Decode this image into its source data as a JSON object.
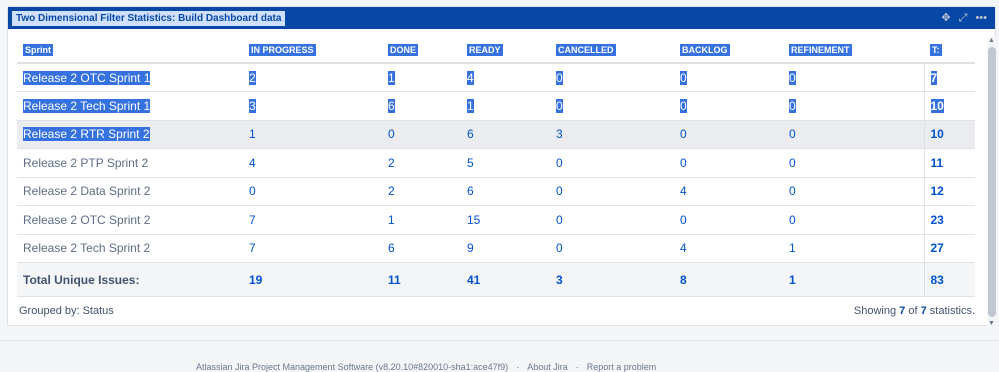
{
  "gadget": {
    "title": "Two Dimensional Filter Statistics: Build Dashboard data",
    "icons": [
      "move-icon",
      "expand-icon",
      "more-icon"
    ]
  },
  "table": {
    "headers": [
      "Sprint",
      "IN PROGRESS",
      "DONE",
      "READY",
      "CANCELLED",
      "BACKLOG",
      "REFINEMENT",
      "T:"
    ],
    "rows": [
      {
        "name": "Release 2 OTC Sprint 1",
        "values": [
          "2",
          "1",
          "4",
          "0",
          "0",
          "0"
        ],
        "total": "7"
      },
      {
        "name": "Release 2 Tech Sprint 1",
        "values": [
          "3",
          "6",
          "1",
          "0",
          "0",
          "0"
        ],
        "total": "10"
      },
      {
        "name": "Release 2 RTR Sprint 2",
        "values": [
          "1",
          "0",
          "6",
          "3",
          "0",
          "0"
        ],
        "total": "10"
      },
      {
        "name": "Release 2 PTP Sprint 2",
        "values": [
          "4",
          "2",
          "5",
          "0",
          "0",
          "0"
        ],
        "total": "11"
      },
      {
        "name": "Release 2 Data Sprint 2",
        "values": [
          "0",
          "2",
          "6",
          "0",
          "4",
          "0"
        ],
        "total": "12"
      },
      {
        "name": "Release 2 OTC Sprint 2",
        "values": [
          "7",
          "1",
          "15",
          "0",
          "0",
          "0"
        ],
        "total": "23"
      },
      {
        "name": "Release 2 Tech Sprint 2",
        "values": [
          "7",
          "6",
          "9",
          "0",
          "4",
          "1"
        ],
        "total": "27"
      }
    ],
    "summary": {
      "label": "Total Unique Issues:",
      "values": [
        "19",
        "11",
        "41",
        "3",
        "8",
        "1"
      ],
      "total": "83"
    }
  },
  "footer": {
    "grouped_by": "Grouped by: Status",
    "showing_prefix": "Showing",
    "shown": "7",
    "of": "of",
    "count": "7",
    "suffix": "statistics."
  },
  "page_footer": {
    "software": "Atlassian Jira Project Management Software (v8.20.10#820010-sha1:ace47f9)",
    "sep": "·",
    "about": "About Jira",
    "report": "Report a problem"
  },
  "colors": {
    "header_blue": "#0747a6",
    "selection": "#3572e0",
    "link": "#0052cc"
  }
}
